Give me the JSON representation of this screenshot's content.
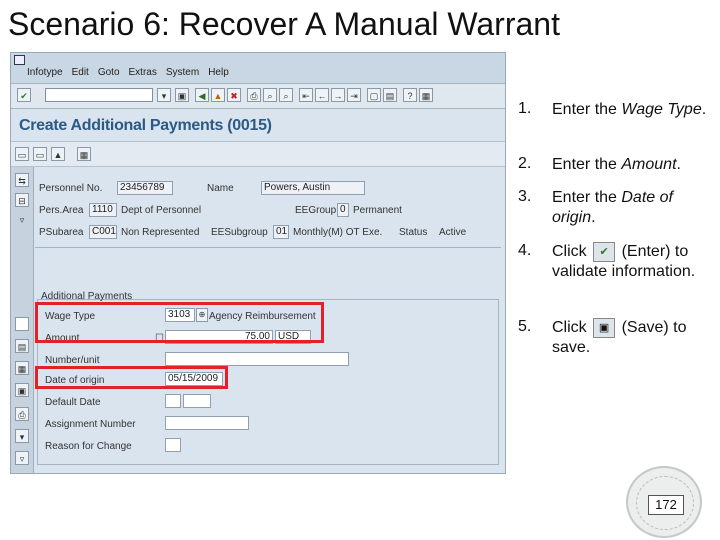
{
  "slide": {
    "title": "Scenario 6: Recover A Manual Warrant",
    "page_number": "172"
  },
  "sap": {
    "menu": [
      "Infotype",
      "Edit",
      "Goto",
      "Extras",
      "System",
      "Help"
    ],
    "screen_title": "Create Additional Payments (0015)",
    "header": {
      "personnel_no_label": "Personnel No.",
      "personnel_no": "23456789",
      "name_label": "Name",
      "name": "Powers, Austin",
      "pers_area_label": "Pers.Area",
      "pers_area_code": "1110",
      "pers_area_text": "Dept of Personnel",
      "ee_group_label": "EEGroup",
      "ee_group_code": "0",
      "ee_group_text": "Permanent",
      "ps_subarea_label": "PSubarea",
      "ps_subarea_code": "C001",
      "ps_subarea_text": "Non Represented",
      "ee_subgroup_label": "EESubgroup",
      "ee_subgroup_code": "01",
      "ee_subgroup_text": "Monthly(M) OT Exe.",
      "status_label": "Status",
      "status_value": "Active"
    },
    "additional_payments": {
      "group_title": "Additional Payments",
      "wage_type_label": "Wage Type",
      "wage_type_code": "3103",
      "wage_type_text": "Agency Reimbursement",
      "amount_label": "Amount",
      "amount_value": "75.00",
      "currency": "USD",
      "number_unit_label": "Number/unit",
      "date_of_origin_label": "Date of origin",
      "date_of_origin": "05/15/2009",
      "default_date_label": "Default Date",
      "assignment_number_label": "Assignment Number",
      "reason_label": "Reason for Change"
    }
  },
  "steps": [
    {
      "num": "1.",
      "text_a": "Enter the ",
      "text_italic": "Wage Type",
      "text_b": "."
    },
    {
      "num": "2.",
      "text_a": "Enter the ",
      "text_italic": "Amount",
      "text_b": "."
    },
    {
      "num": "3.",
      "text_a": "Enter the ",
      "text_italic": "Date of origin",
      "text_b": "."
    },
    {
      "num": "4.",
      "text_a": "Click",
      "text_b": "(Enter) to validate information.",
      "icon": "enter-checkmark-icon"
    },
    {
      "num": "5.",
      "text_a": "Click",
      "text_b": "(Save) to save.",
      "icon": "save-floppy-icon"
    }
  ],
  "colors": {
    "highlight": "#e3212b",
    "title_blue": "#2c5a86",
    "sap_bg": "#d9e4ee"
  }
}
